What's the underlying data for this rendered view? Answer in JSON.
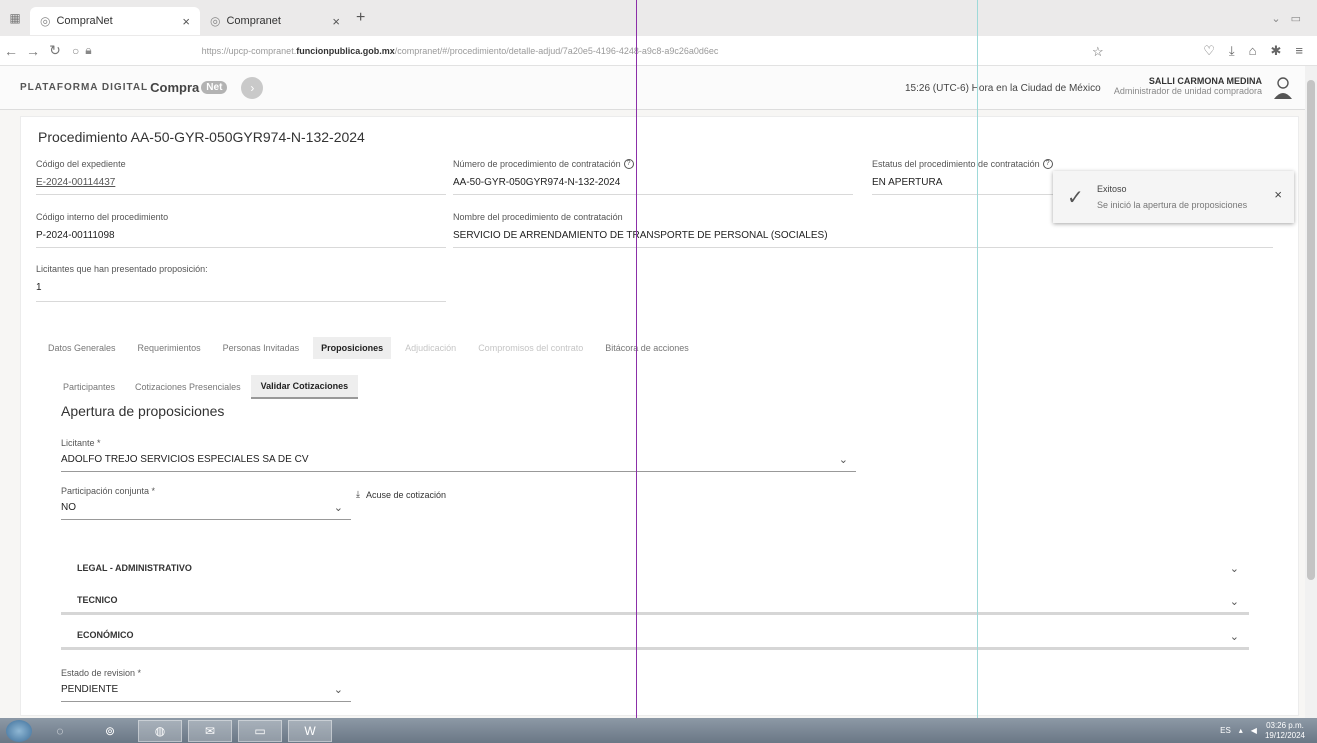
{
  "browser": {
    "tabs": [
      {
        "title": "CompraNet",
        "active": true
      },
      {
        "title": "Compranet",
        "active": false
      }
    ],
    "url_prefix": "https://upcp-compranet.",
    "url_host": "funcionpublica.gob.mx",
    "url_path": "/compranet/#/procedimiento/detalle-adjud/7a20e5-4196-4248-a9c8-a9c26a0d6ec"
  },
  "header": {
    "logo_platform": "PLATAFORMA DIGITAL",
    "logo_name": "Compra",
    "logo_badge": "Net",
    "clock": "15:26 (UTC-6) Hora en la Ciudad de México",
    "user_name": "SALLI CARMONA MEDINA",
    "user_role": "Administrador de unidad compradora"
  },
  "procedure": {
    "title": "Procedimiento AA-50-GYR-050GYR974-N-132-2024",
    "fields": {
      "codigo_expediente_label": "Código del expediente",
      "codigo_expediente_value": "E-2024-00114437",
      "numero_label": "Número de procedimiento de contratación",
      "numero_value": "AA-50-GYR-050GYR974-N-132-2024",
      "estatus_label": "Estatus del procedimiento de contratación",
      "estatus_value": "EN APERTURA",
      "codigo_interno_label": "Código interno del procedimiento",
      "codigo_interno_value": "P-2024-00111098",
      "nombre_label": "Nombre del procedimiento de contratación",
      "nombre_value": "SERVICIO DE ARRENDAMIENTO DE TRANSPORTE DE PERSONAL (SOCIALES)",
      "licitantes_label": "Licitantes que han presentado proposición:",
      "licitantes_value": "1"
    }
  },
  "toast": {
    "title": "Exitoso",
    "message": "Se inició la apertura de proposiciones"
  },
  "tabs": [
    "Datos Generales",
    "Requerimientos",
    "Personas Invitadas",
    "Proposiciones",
    "Adjudicación",
    "Compromisos del contrato",
    "Bitácora de acciones"
  ],
  "subtabs": [
    "Participantes",
    "Cotizaciones Presenciales",
    "Validar Cotizaciones"
  ],
  "apertura": {
    "title": "Apertura de proposiciones",
    "licitante_label": "Licitante *",
    "licitante_value": "ADOLFO TREJO SERVICIOS ESPECIALES SA DE CV",
    "participacion_label": "Participación conjunta *",
    "participacion_value": "NO",
    "acuse_label": "Acuse de cotización",
    "sections": [
      "LEGAL - ADMINISTRATIVO",
      "TECNICO",
      "ECONÓMICO"
    ],
    "estado_label": "Estado de revision *",
    "estado_value": "PENDIENTE"
  },
  "taskbar": {
    "lang": "ES",
    "time": "03:26 p.m.",
    "date": "19/12/2024"
  }
}
